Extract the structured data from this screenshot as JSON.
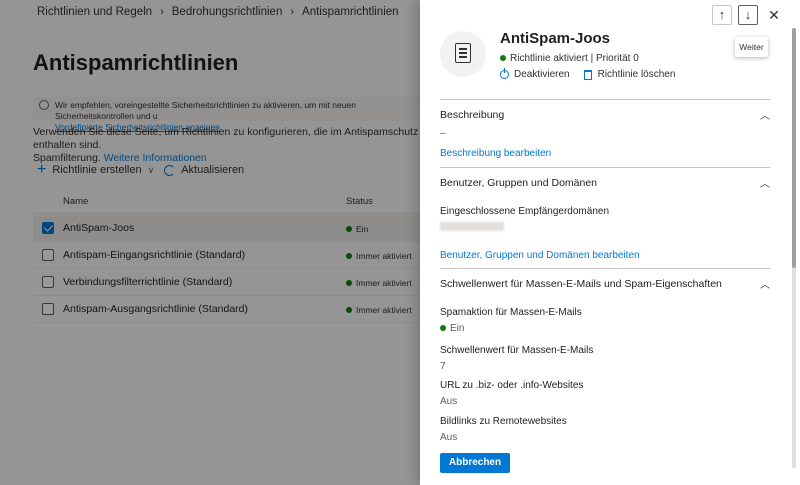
{
  "background": {
    "breadcrumb": [
      "Richtlinien und Regeln",
      "Bedrohungsrichtlinien",
      "Antispamrichtlinien"
    ],
    "page_title": "Antispamrichtlinien",
    "tip": {
      "text": "Wir empfehlen, voreingestellte Sicherheitsrichtlinien zu aktivieren, um mit neuen Sicherheitskontrollen und u",
      "link": "Vordefinierte Sicherheitsrichtlinien anzeigen"
    },
    "intro": {
      "text1": "Verwenden Sie diese Seite, um Richtlinien zu konfigurieren, die im Antispamschutz enthalten sind.",
      "text2": "Spamfilterung.",
      "link": "Weitere Informationen"
    },
    "commands": {
      "create": "Richtlinie erstellen",
      "refresh": "Aktualisieren"
    },
    "table": {
      "headers": {
        "name": "Name",
        "status": "Status"
      },
      "rows": [
        {
          "name": "AntiSpam-Joos",
          "status": "Ein",
          "selected": true
        },
        {
          "name": "Antispam-Eingangsrichtlinie (Standard)",
          "status": "Immer aktiviert",
          "selected": false
        },
        {
          "name": "Verbindungsfilterrichtlinie (Standard)",
          "status": "Immer aktiviert",
          "selected": false
        },
        {
          "name": "Antispam-Ausgangsrichtlinie (Standard)",
          "status": "Immer aktiviert",
          "selected": false
        }
      ]
    }
  },
  "panel": {
    "tooltip": "Weiter",
    "title": "AntiSpam-Joos",
    "status_text": "Richtlinie aktiviert | Priorität 0",
    "actions": {
      "deactivate": "Deaktivieren",
      "delete": "Richtlinie löschen"
    },
    "description": {
      "header": "Beschreibung",
      "value": "–",
      "edit_link": "Beschreibung bearbeiten"
    },
    "users": {
      "header": "Benutzer, Gruppen und Domänen",
      "label": "Eingeschlossene Empfängerdomänen",
      "edit_link": "Benutzer, Gruppen und Domänen bearbeiten"
    },
    "threshold": {
      "header": "Schwellenwert für Massen-E-Mails und Spam-Eigenschaften",
      "fields": [
        {
          "label": "Spamaktion für Massen-E-Mails",
          "value": "Ein"
        },
        {
          "label": "Schwellenwert für Massen-E-Mails",
          "value": "7"
        },
        {
          "label": "URL zu .biz- oder .info-Websites",
          "value": "Aus"
        },
        {
          "label": "Bildlinks zu Remotewebsites",
          "value": "Aus"
        }
      ]
    },
    "cancel_label": "Abbrechen",
    "colors": {
      "accent": "#0078d4",
      "status_green": "#107c10"
    }
  }
}
